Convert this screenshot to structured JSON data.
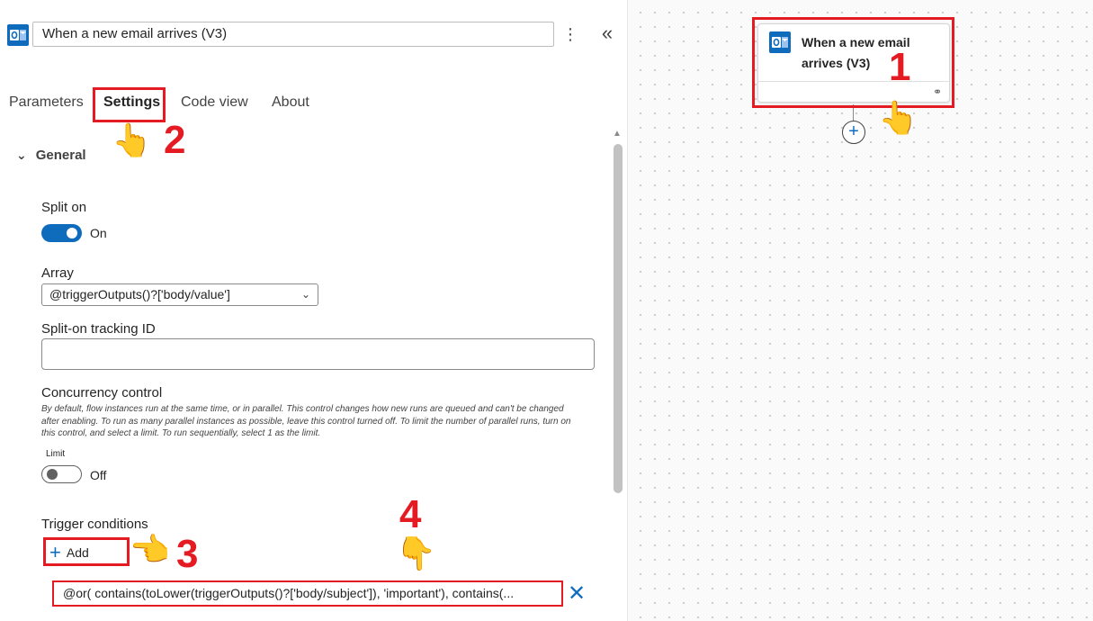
{
  "panel": {
    "title": "When a new email arrives (V3)",
    "more_icon": "more-vertical-icon",
    "collapse_icon": "double-chevron-left-icon"
  },
  "tabs": [
    {
      "label": "Parameters",
      "active": false
    },
    {
      "label": "Settings",
      "active": true
    },
    {
      "label": "Code view",
      "active": false
    },
    {
      "label": "About",
      "active": false
    }
  ],
  "general": {
    "heading": "General",
    "split_on": {
      "label": "Split on",
      "state_text": "On",
      "enabled": true
    },
    "array": {
      "label": "Array",
      "value": "@triggerOutputs()?['body/value']"
    },
    "tracking_id": {
      "label": "Split-on tracking ID",
      "value": ""
    },
    "concurrency": {
      "label": "Concurrency control",
      "description": "By default, flow instances run at the same time, or in parallel. This control changes how new runs are queued and can't be changed after enabling. To run as many parallel instances as possible, leave this control turned off. To limit the number of parallel runs, turn on this control, and select a limit. To run sequentially, select 1 as the limit.",
      "limit_label": "Limit",
      "state_text": "Off",
      "enabled": false
    },
    "trigger_conditions": {
      "label": "Trigger conditions",
      "add_label": "Add",
      "condition": "@or(    contains(toLower(triggerOutputs()?['body/subject']), 'important'),    contains(..."
    }
  },
  "canvas": {
    "card_title": "When a new email arrives (V3)"
  },
  "annotations": {
    "step1": "1",
    "step2": "2",
    "step3": "3",
    "step4": "4"
  },
  "colors": {
    "accent": "#0f6cbd",
    "highlight": "#e41b23"
  }
}
